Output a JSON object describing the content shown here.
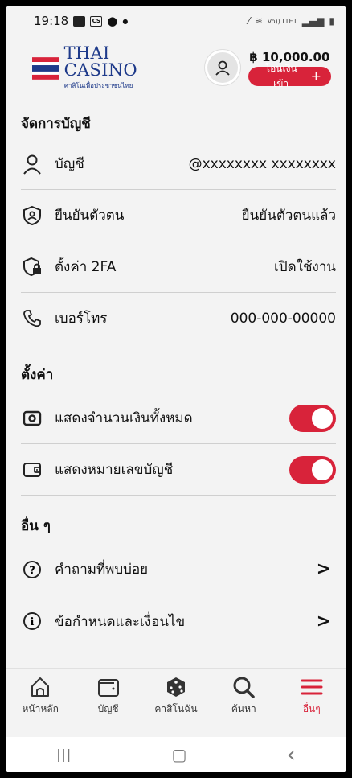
{
  "status": {
    "time": "19:18",
    "network": "VoLTE",
    "signal_label": "Vo)) LTE1"
  },
  "header": {
    "brand_title": "THAI CASINO",
    "brand_sub": "คาสิโนเพื่อประชาชนไทย",
    "balance": "฿ 10,000.00",
    "deposit_label": "โอนเงินเข้า",
    "deposit_plus": "+"
  },
  "account": {
    "title": "จัดการบัญชี",
    "rows": [
      {
        "icon": "user-icon",
        "label": "บัญชี",
        "value": "@xxxxxxxx xxxxxxxx"
      },
      {
        "icon": "id-verify-icon",
        "label": "ยืนยันตัวตน",
        "value": "ยืนยันตัวตนแล้ว"
      },
      {
        "icon": "shield-lock-icon",
        "label": "ตั้งค่า 2FA",
        "value": "เปิดใช้งาน"
      },
      {
        "icon": "phone-icon",
        "label": "เบอร์โทร",
        "value": "000-000-00000"
      }
    ]
  },
  "settings": {
    "title": "ตั้งค่า",
    "rows": [
      {
        "icon": "cash-icon",
        "label": "แสดงจำนวนเงินทั้งหมด",
        "enabled": true
      },
      {
        "icon": "wallet-icon",
        "label": "แสดงหมายเลขบัญชี",
        "enabled": true
      }
    ]
  },
  "other": {
    "title": "อื่น ๆ",
    "rows": [
      {
        "icon": "question-icon",
        "label": "คำถามที่พบบ่อย",
        "chevron": ">"
      },
      {
        "icon": "info-icon",
        "label": "ข้อกำหนดและเงื่อนไข",
        "chevron": ">"
      }
    ]
  },
  "nav": [
    {
      "icon": "home-icon",
      "label": "หน้าหลัก"
    },
    {
      "icon": "wallet-icon",
      "label": "บัญชี"
    },
    {
      "icon": "dice-icon",
      "label": "คาสิโนฉัน"
    },
    {
      "icon": "search-icon",
      "label": "ค้นหา"
    },
    {
      "icon": "menu-icon",
      "label": "อื่นๆ",
      "active": true
    }
  ],
  "sysnav": {
    "recent": "|||",
    "home": "▢",
    "back": "‹"
  },
  "colors": {
    "accent": "#d8233a",
    "brand": "#1e3a8a"
  }
}
